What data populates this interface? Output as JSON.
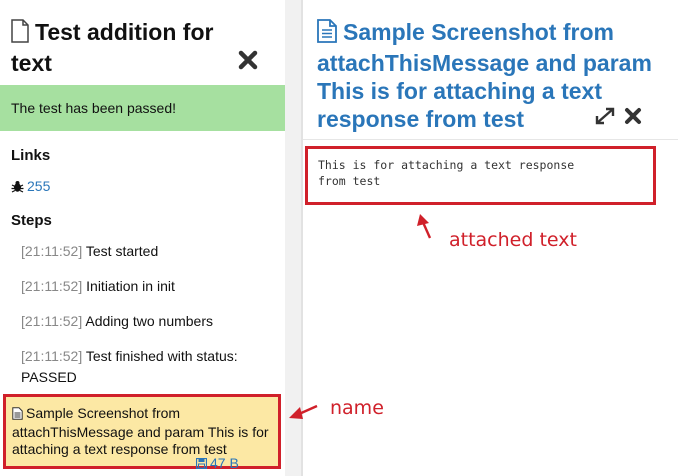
{
  "left_panel": {
    "title": "Test addition for text",
    "status_message": "The test has been passed!",
    "links_heading": "Links",
    "link_label": "255",
    "steps_heading": "Steps",
    "steps": [
      {
        "time": "[21:11:52]",
        "text": "Test started"
      },
      {
        "time": "[21:11:52]",
        "text": "Initiation in init"
      },
      {
        "time": "[21:11:52]",
        "text": "Adding two numbers"
      },
      {
        "time": "[21:11:52]",
        "text": "Test finished with status: PASSED"
      }
    ],
    "attachment": {
      "name": "Sample Screenshot from attachThisMessage and param This is for attaching a text response from test",
      "size": "47 B"
    }
  },
  "right_panel": {
    "title": "Sample Screenshot from attachThisMessage and param This is for attaching a text response from test",
    "content_text": "This is for attaching a text response\nfrom test"
  },
  "annotations": {
    "text_label": "attached text",
    "name_label": "name"
  },
  "colors": {
    "accent_blue": "#2a76b9",
    "success_green": "#a6e0a0",
    "highlight_yellow": "#fce8a4",
    "annotation_red": "#d0202a"
  }
}
